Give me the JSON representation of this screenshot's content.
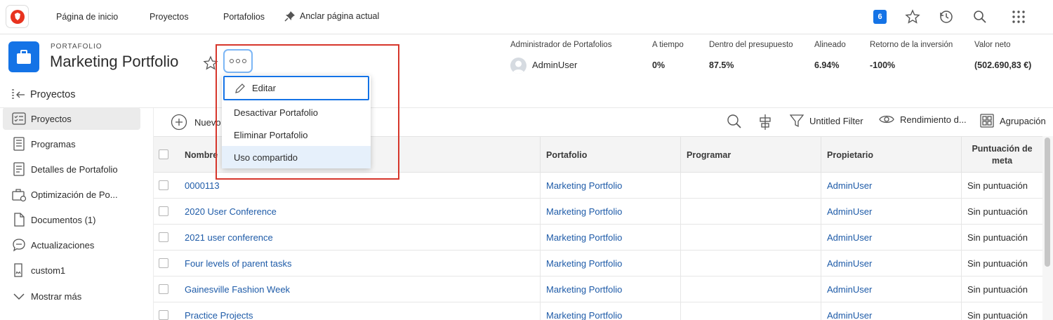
{
  "topnav": {
    "home": "Página de inicio",
    "projects": "Proyectos",
    "portfolios": "Portafolios",
    "pin": "Anclar página actual",
    "badge": "6"
  },
  "portfolio": {
    "type_label": "PORTAFOLIO",
    "title": "Marketing Portfolio"
  },
  "metrics": [
    {
      "label": "Administrador de Portafolios",
      "value": "AdminUser"
    },
    {
      "label": "A tiempo",
      "value": "0%"
    },
    {
      "label": "Dentro del presupuesto",
      "value": "87.5%"
    },
    {
      "label": "Alineado",
      "value": "6.94%"
    },
    {
      "label": "Retorno de la inversión",
      "value": "-100%"
    },
    {
      "label": "Valor neto",
      "value": "(502.690,83 €)"
    }
  ],
  "sidebar": {
    "title": "Proyectos",
    "items": [
      {
        "label": "Proyectos",
        "icon": "projects-list-icon"
      },
      {
        "label": "Programas",
        "icon": "programs-icon"
      },
      {
        "label": "Detalles de Portafolio",
        "icon": "details-icon"
      },
      {
        "label": "Optimización de Po...",
        "icon": "optimizer-icon"
      },
      {
        "label": "Documentos (1)",
        "icon": "document-icon"
      },
      {
        "label": "Actualizaciones",
        "icon": "updates-icon"
      },
      {
        "label": "custom1",
        "icon": "custom-icon"
      },
      {
        "label": "Mostrar más",
        "icon": "chevron-down-icon"
      }
    ]
  },
  "toolbar": {
    "new": "Nuevo",
    "filter": "Untitled Filter",
    "view": "Rendimiento d...",
    "grouping": "Agrupación"
  },
  "table": {
    "columns": [
      "Nombre",
      "Portafolio",
      "Programar",
      "Propietario",
      "Puntuación de meta"
    ],
    "rows": [
      {
        "name": "0000113",
        "portfolio": "Marketing Portfolio",
        "schedule": "",
        "owner": "AdminUser",
        "score": "Sin puntuación"
      },
      {
        "name": "2020 User Conference",
        "portfolio": "Marketing Portfolio",
        "schedule": "",
        "owner": "AdminUser",
        "score": "Sin puntuación"
      },
      {
        "name": "2021 user conference",
        "portfolio": "Marketing Portfolio",
        "schedule": "",
        "owner": "AdminUser",
        "score": "Sin puntuación"
      },
      {
        "name": "Four levels of parent tasks",
        "portfolio": "Marketing Portfolio",
        "schedule": "",
        "owner": "AdminUser",
        "score": "Sin puntuación"
      },
      {
        "name": "Gainesville Fashion Week",
        "portfolio": "Marketing Portfolio",
        "schedule": "",
        "owner": "AdminUser",
        "score": "Sin puntuación"
      },
      {
        "name": "Practice Projects",
        "portfolio": "Marketing Portfolio",
        "schedule": "",
        "owner": "AdminUser",
        "score": "Sin puntuación"
      }
    ]
  },
  "menu": {
    "items": [
      "Editar",
      "Desactivar Portafolio",
      "Eliminar Portafolio",
      "Uso compartido"
    ]
  },
  "colors": {
    "accent": "#1473e6",
    "link": "#1e5ba8",
    "highlight_box": "#d6362b",
    "logo": "#e8331f"
  }
}
